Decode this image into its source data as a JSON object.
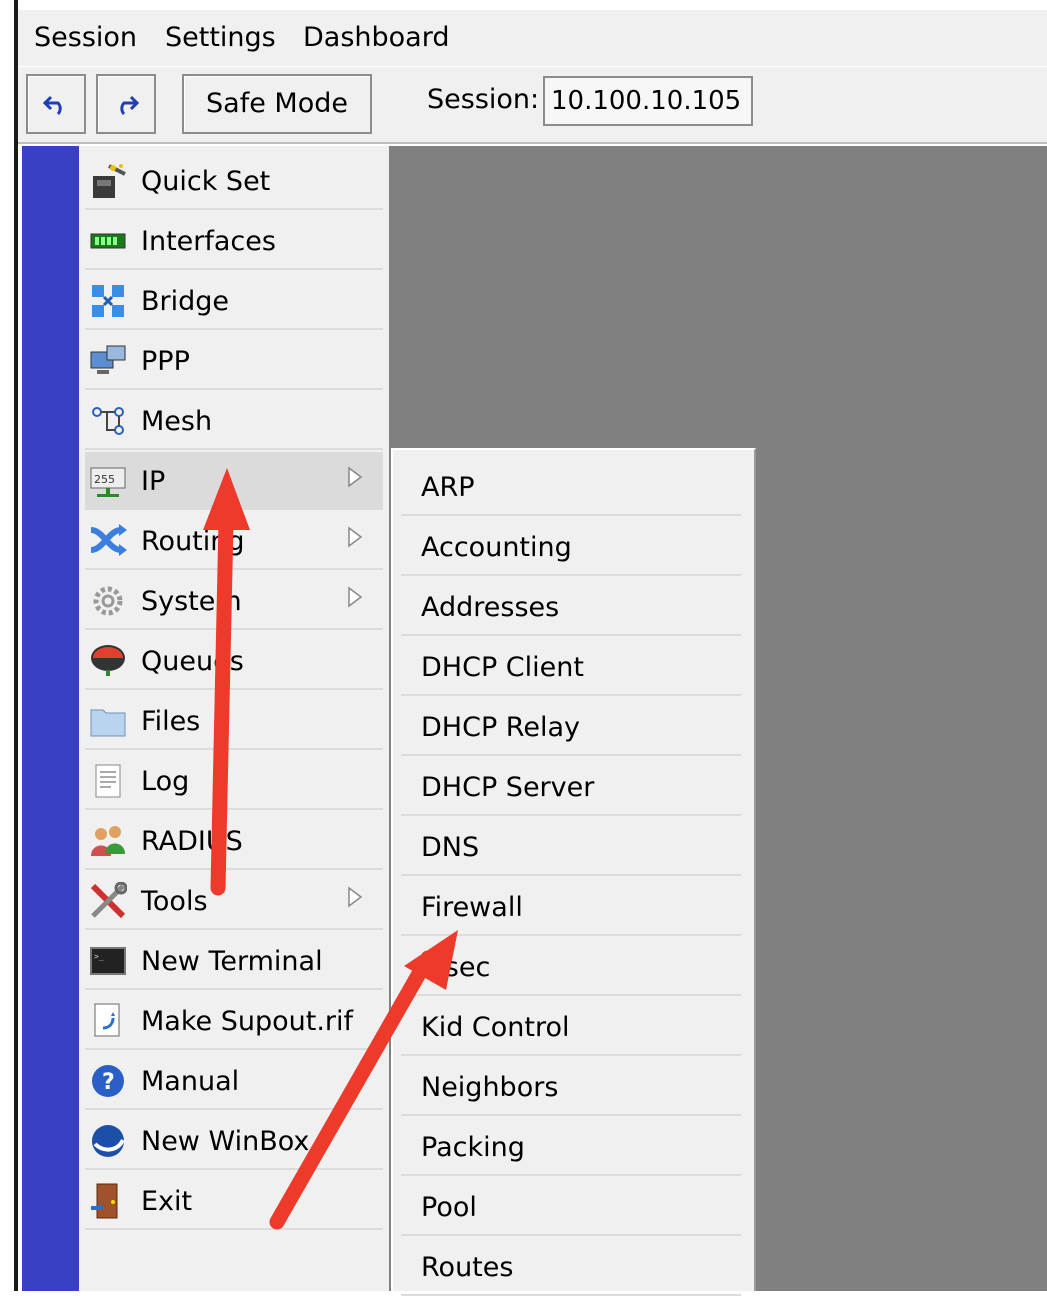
{
  "menubar": {
    "session": "Session",
    "settings": "Settings",
    "dashboard": "Dashboard"
  },
  "toolbar": {
    "undo_icon": "undo-icon",
    "redo_icon": "redo-icon",
    "safe_mode": "Safe Mode",
    "session_label": "Session:",
    "session_value": "10.100.10.105"
  },
  "sidebar": {
    "items": [
      {
        "label": "Quick Set",
        "icon": "quick-set-icon"
      },
      {
        "label": "Interfaces",
        "icon": "interfaces-icon"
      },
      {
        "label": "Bridge",
        "icon": "bridge-icon"
      },
      {
        "label": "PPP",
        "icon": "ppp-icon"
      },
      {
        "label": "Mesh",
        "icon": "mesh-icon"
      },
      {
        "label": "IP",
        "icon": "ip-icon",
        "submenu": true,
        "active": true
      },
      {
        "label": "Routing",
        "icon": "routing-icon",
        "submenu": true
      },
      {
        "label": "System",
        "icon": "system-icon",
        "submenu": true
      },
      {
        "label": "Queues",
        "icon": "queues-icon"
      },
      {
        "label": "Files",
        "icon": "files-icon"
      },
      {
        "label": "Log",
        "icon": "log-icon"
      },
      {
        "label": "RADIUS",
        "icon": "radius-icon"
      },
      {
        "label": "Tools",
        "icon": "tools-icon",
        "submenu": true
      },
      {
        "label": "New Terminal",
        "icon": "terminal-icon"
      },
      {
        "label": "Make Supout.rif",
        "icon": "supout-icon"
      },
      {
        "label": "Manual",
        "icon": "help-icon"
      },
      {
        "label": "New WinBox",
        "icon": "winbox-icon"
      },
      {
        "label": "Exit",
        "icon": "exit-icon"
      }
    ]
  },
  "ip_submenu": {
    "items": [
      "ARP",
      "Accounting",
      "Addresses",
      "DHCP Client",
      "DHCP Relay",
      "DHCP Server",
      "DNS",
      "Firewall",
      "IPsec",
      "Kid Control",
      "Neighbors",
      "Packing",
      "Pool",
      "Routes"
    ]
  },
  "colors": {
    "accent_strip": "#3a40c4",
    "annotation_arrow": "#ee3a2a",
    "desktop": "#808080"
  }
}
